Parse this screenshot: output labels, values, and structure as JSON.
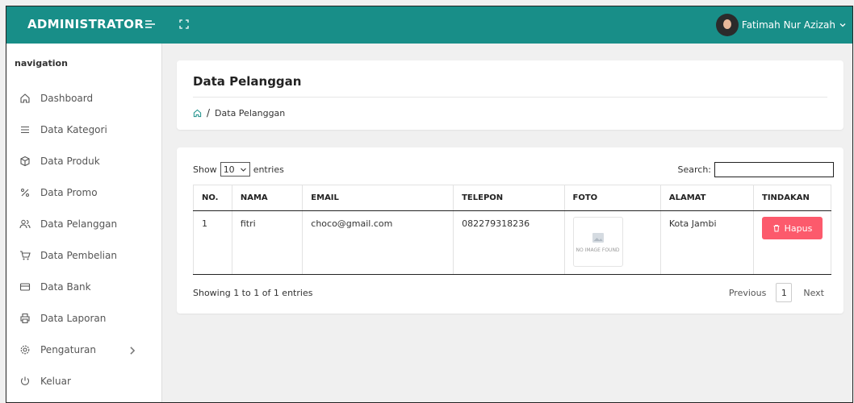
{
  "header": {
    "brand": "ADMINISTRATOR",
    "user_name": "Fatimah Nur Azizah"
  },
  "sidebar": {
    "title": "navigation",
    "items": [
      {
        "label": "Dashboard",
        "icon": "home-icon"
      },
      {
        "label": "Data Kategori",
        "icon": "list-icon"
      },
      {
        "label": "Data Produk",
        "icon": "box-icon"
      },
      {
        "label": "Data Promo",
        "icon": "percent-icon"
      },
      {
        "label": "Data Pelanggan",
        "icon": "users-icon"
      },
      {
        "label": "Data Pembelian",
        "icon": "cart-icon"
      },
      {
        "label": "Data Bank",
        "icon": "card-icon"
      },
      {
        "label": "Data Laporan",
        "icon": "printer-icon"
      },
      {
        "label": "Pengaturan",
        "icon": "gear-icon"
      },
      {
        "label": "Keluar",
        "icon": "power-icon"
      }
    ]
  },
  "page": {
    "title": "Data Pelanggan",
    "breadcrumb": "Data Pelanggan"
  },
  "table_controls": {
    "show_label": "Show",
    "entries_value": "10",
    "entries_label": "entries",
    "search_label": "Search:",
    "search_value": ""
  },
  "table": {
    "columns": [
      "NO.",
      "NAMA",
      "EMAIL",
      "TELEPON",
      "FOTO",
      "ALAMAT",
      "TINDAKAN"
    ],
    "rows": [
      {
        "no": "1",
        "nama": "fitri",
        "email": "choco@gmail.com",
        "telepon": "082279318236",
        "foto_text": "NO IMAGE FOUND",
        "alamat": "Kota Jambi",
        "action_label": "Hapus"
      }
    ]
  },
  "footer": {
    "info": "Showing 1 to 1 of 1 entries",
    "previous": "Previous",
    "page": "1",
    "next": "Next"
  },
  "colors": {
    "topbar": "#188e88",
    "danger": "#fc5a6c"
  }
}
